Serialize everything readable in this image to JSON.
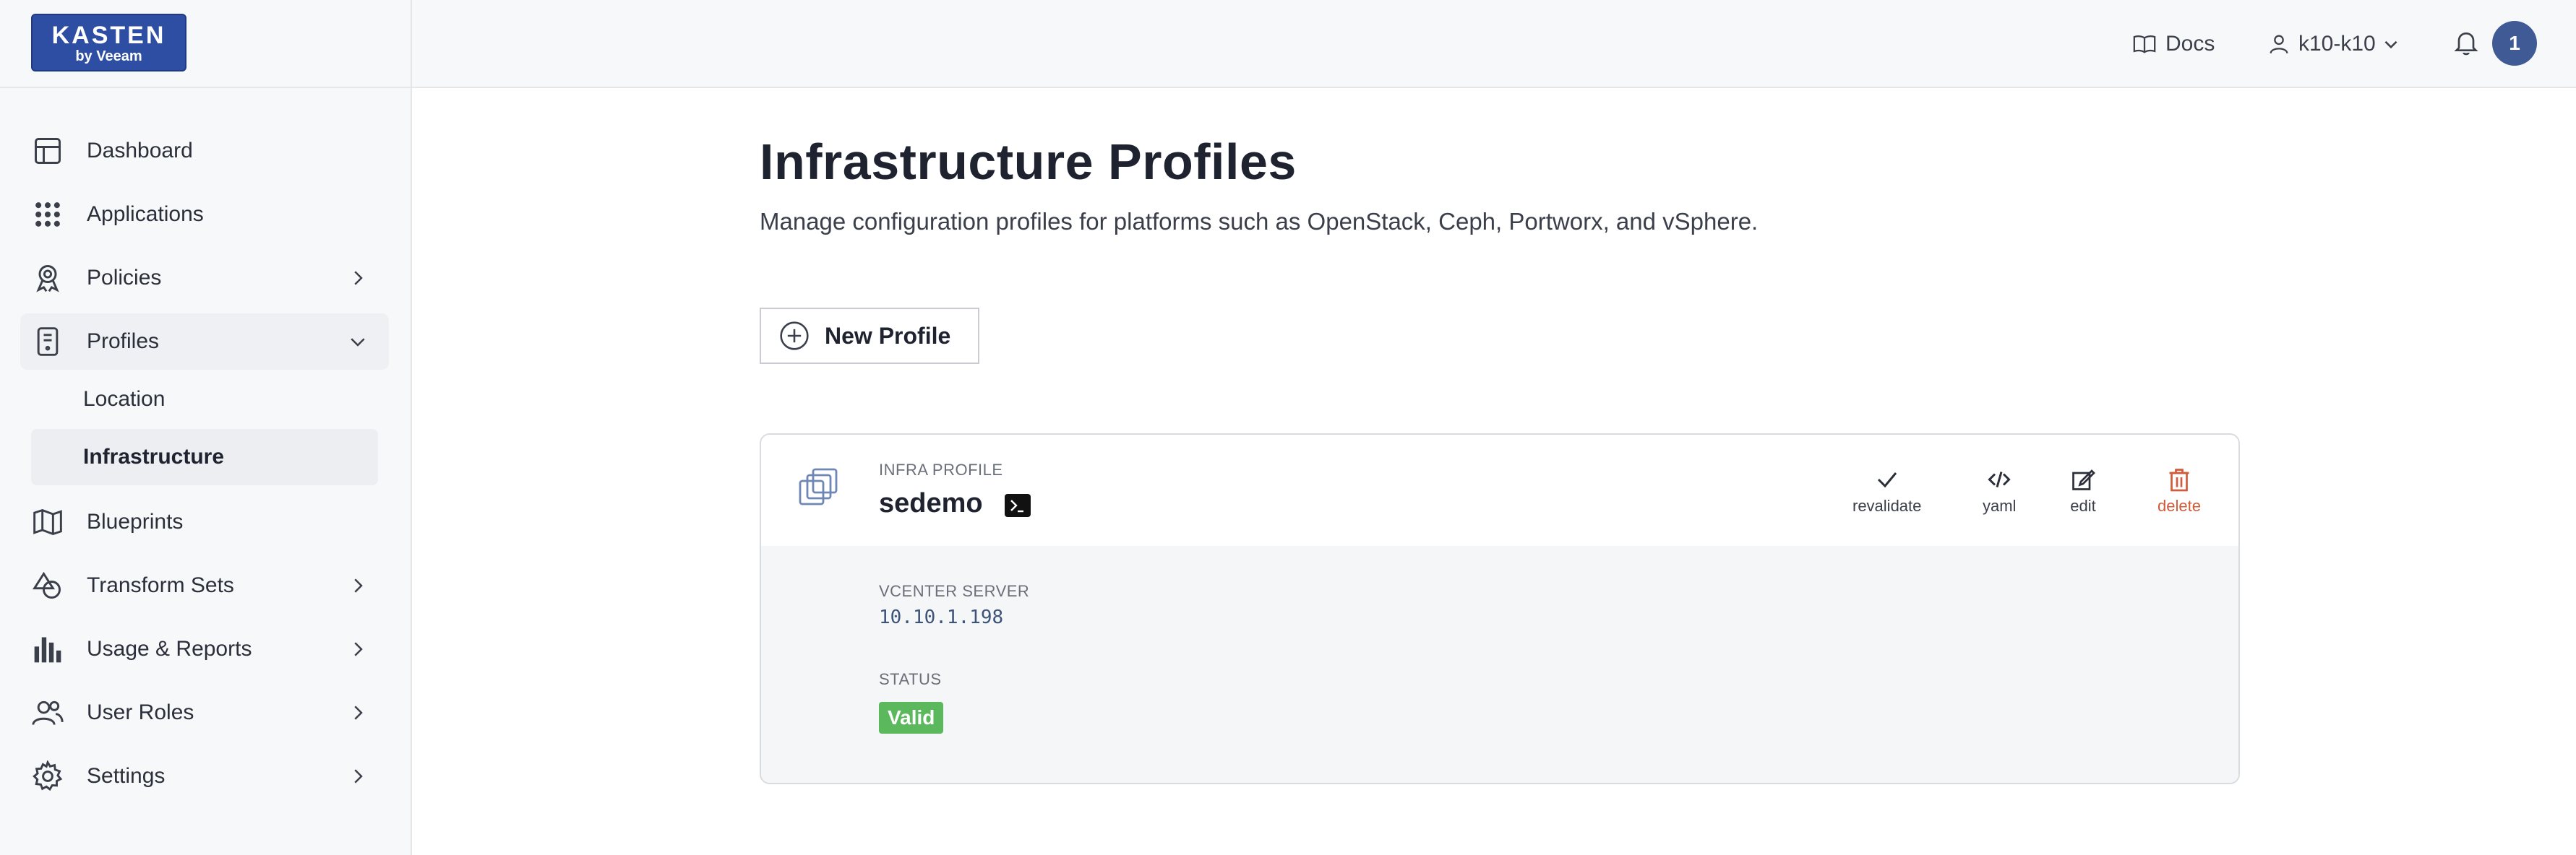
{
  "brand": {
    "name": "KASTEN",
    "tagline": "by Veeam"
  },
  "header": {
    "docs_label": "Docs",
    "user_label": "k10-k10",
    "notification_count": "1"
  },
  "sidebar": {
    "items": [
      {
        "label": "Dashboard",
        "icon": "dashboard-icon"
      },
      {
        "label": "Applications",
        "icon": "applications-grid-icon"
      },
      {
        "label": "Policies",
        "icon": "policies-award-icon"
      },
      {
        "label": "Profiles",
        "icon": "profiles-icon"
      },
      {
        "label": "Blueprints",
        "icon": "blueprints-map-icon"
      },
      {
        "label": "Transform Sets",
        "icon": "transform-sets-icon"
      },
      {
        "label": "Usage & Reports",
        "icon": "usage-reports-chart-icon"
      },
      {
        "label": "User Roles",
        "icon": "user-roles-icon"
      },
      {
        "label": "Settings",
        "icon": "settings-gear-icon"
      }
    ],
    "profile_sub": [
      {
        "label": "Location"
      },
      {
        "label": "Infrastructure"
      }
    ]
  },
  "main": {
    "title": "Infrastructure Profiles",
    "subtitle": "Manage configuration profiles for platforms such as OpenStack, Ceph, Portworx, and vSphere.",
    "new_button_label": "New Profile"
  },
  "profile_card": {
    "kicker": "INFRA PROFILE",
    "name": "sedemo",
    "actions": {
      "revalidate": "revalidate",
      "yaml": "yaml",
      "edit": "edit",
      "delete": "delete"
    },
    "vcenter_label": "VCENTER SERVER",
    "vcenter_value": "10.10.1.198",
    "status_label": "STATUS",
    "status_value": "Valid"
  },
  "colors": {
    "brand": "#2d4ea3",
    "avatar": "#3f5a94",
    "valid_badge": "#5cb85c",
    "delete_action": "#d25b3a"
  }
}
